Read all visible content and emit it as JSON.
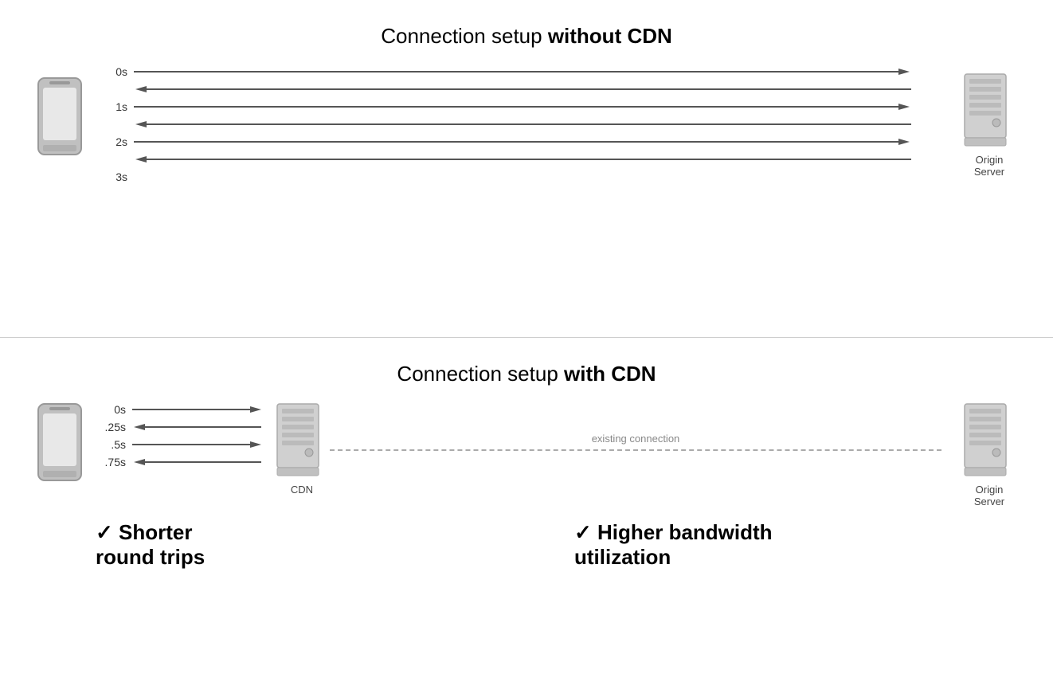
{
  "top_section": {
    "title_normal": "Connection setup ",
    "title_bold": "without CDN",
    "time_labels": [
      "0s",
      "1s",
      "2s",
      "3s"
    ],
    "server_label": "Origin\nServer"
  },
  "bottom_section": {
    "title_normal": "Connection setup ",
    "title_bold": "with CDN",
    "time_labels": [
      "0s",
      ".25s",
      ".5s",
      ".75s"
    ],
    "cdn_label": "CDN",
    "server_label": "Origin\nServer",
    "existing_connection_label": "existing connection",
    "benefit1": "✓ Shorter\nround trips",
    "benefit2": "✓ Higher bandwidth\nutilization"
  }
}
